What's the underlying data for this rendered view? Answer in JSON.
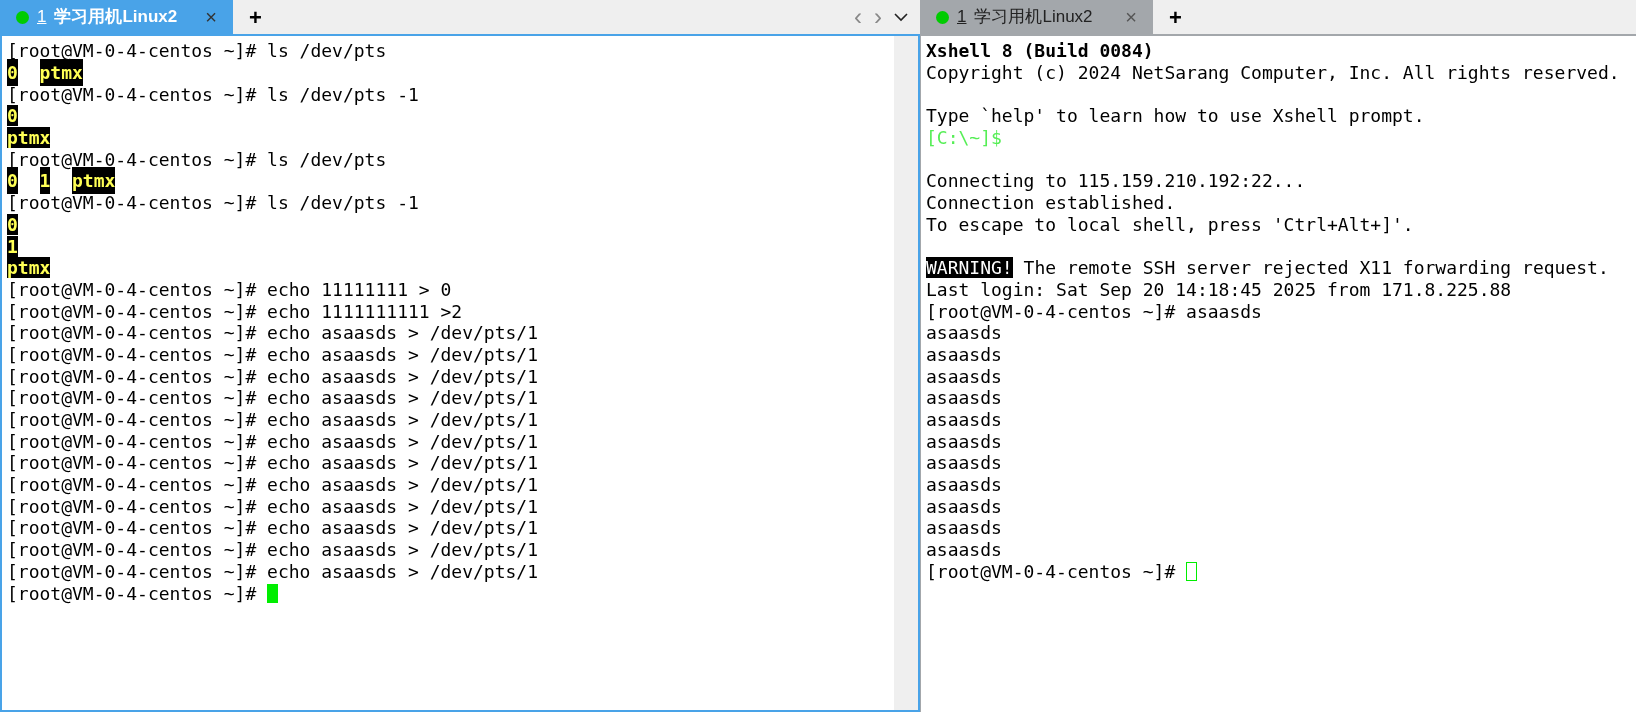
{
  "panes": [
    {
      "focused": true,
      "tab": {
        "color": "#00cc00",
        "number": "1",
        "title": "学习用机Linux2",
        "close": "×"
      },
      "new_tab": "+",
      "nav": {
        "prev": "‹",
        "next": "›"
      },
      "lines": [
        {
          "segments": [
            {
              "text": "[root@VM-0-4-centos ~]# ls /dev/pts",
              "kind": "plain"
            }
          ]
        },
        {
          "kind": "columns",
          "items": [
            "0",
            "ptmx"
          ]
        },
        {
          "segments": [
            {
              "text": "[root@VM-0-4-centos ~]# ls /dev/pts -1",
              "kind": "plain"
            }
          ]
        },
        {
          "segments": [
            {
              "text": "0",
              "kind": "highlight"
            }
          ]
        },
        {
          "segments": [
            {
              "text": "ptmx",
              "kind": "highlight"
            }
          ]
        },
        {
          "segments": [
            {
              "text": "[root@VM-0-4-centos ~]# ls /dev/pts",
              "kind": "plain"
            }
          ]
        },
        {
          "kind": "columns",
          "items": [
            "0",
            "1",
            "ptmx"
          ]
        },
        {
          "segments": [
            {
              "text": "[root@VM-0-4-centos ~]# ls /dev/pts -1",
              "kind": "plain"
            }
          ]
        },
        {
          "segments": [
            {
              "text": "0",
              "kind": "highlight"
            }
          ]
        },
        {
          "segments": [
            {
              "text": "1",
              "kind": "highlight"
            }
          ]
        },
        {
          "segments": [
            {
              "text": "ptmx",
              "kind": "highlight"
            }
          ]
        },
        {
          "segments": [
            {
              "text": "[root@VM-0-4-centos ~]# echo 11111111 > 0",
              "kind": "plain"
            }
          ]
        },
        {
          "segments": [
            {
              "text": "[root@VM-0-4-centos ~]# echo 1111111111 >2",
              "kind": "plain"
            }
          ]
        },
        {
          "segments": [
            {
              "text": "[root@VM-0-4-centos ~]# echo asaasds > /dev/pts/1",
              "kind": "plain"
            }
          ]
        },
        {
          "segments": [
            {
              "text": "[root@VM-0-4-centos ~]# echo asaasds > /dev/pts/1",
              "kind": "plain"
            }
          ]
        },
        {
          "segments": [
            {
              "text": "[root@VM-0-4-centos ~]# echo asaasds > /dev/pts/1",
              "kind": "plain"
            }
          ]
        },
        {
          "segments": [
            {
              "text": "[root@VM-0-4-centos ~]# echo asaasds > /dev/pts/1",
              "kind": "plain"
            }
          ]
        },
        {
          "segments": [
            {
              "text": "[root@VM-0-4-centos ~]# echo asaasds > /dev/pts/1",
              "kind": "plain"
            }
          ]
        },
        {
          "segments": [
            {
              "text": "[root@VM-0-4-centos ~]# echo asaasds > /dev/pts/1",
              "kind": "plain"
            }
          ]
        },
        {
          "segments": [
            {
              "text": "[root@VM-0-4-centos ~]# echo asaasds > /dev/pts/1",
              "kind": "plain"
            }
          ]
        },
        {
          "segments": [
            {
              "text": "[root@VM-0-4-centos ~]# echo asaasds > /dev/pts/1",
              "kind": "plain"
            }
          ]
        },
        {
          "segments": [
            {
              "text": "[root@VM-0-4-centos ~]# echo asaasds > /dev/pts/1",
              "kind": "plain"
            }
          ]
        },
        {
          "segments": [
            {
              "text": "[root@VM-0-4-centos ~]# echo asaasds > /dev/pts/1",
              "kind": "plain"
            }
          ]
        },
        {
          "segments": [
            {
              "text": "[root@VM-0-4-centos ~]# echo asaasds > /dev/pts/1",
              "kind": "plain"
            }
          ]
        },
        {
          "segments": [
            {
              "text": "[root@VM-0-4-centos ~]# echo asaasds > /dev/pts/1",
              "kind": "plain"
            }
          ]
        },
        {
          "segments": [
            {
              "text": "[root@VM-0-4-centos ~]# ",
              "kind": "plain"
            }
          ],
          "cursor": true
        }
      ]
    },
    {
      "focused": false,
      "tab": {
        "color": "#00cc00",
        "number": "1",
        "title": "学习用机Linux2",
        "close": "×"
      },
      "new_tab": "+",
      "lines": [
        {
          "segments": [
            {
              "text": "Xshell 8 (Build 0084)",
              "kind": "bold"
            }
          ]
        },
        {
          "segments": [
            {
              "text": "Copyright (c) 2024 NetSarang Computer, Inc. All rights reserved.",
              "kind": "plain"
            }
          ]
        },
        {
          "kind": "blank"
        },
        {
          "segments": [
            {
              "text": "Type `help' to learn how to use Xshell prompt.",
              "kind": "plain"
            }
          ]
        },
        {
          "segments": [
            {
              "text": "[C:\\~]$",
              "kind": "green"
            }
          ]
        },
        {
          "kind": "blank"
        },
        {
          "segments": [
            {
              "text": "Connecting to 115.159.210.192:22...",
              "kind": "plain"
            }
          ]
        },
        {
          "segments": [
            {
              "text": "Connection established.",
              "kind": "plain"
            }
          ]
        },
        {
          "segments": [
            {
              "text": "To escape to local shell, press 'Ctrl+Alt+]'.",
              "kind": "plain"
            }
          ]
        },
        {
          "kind": "blank"
        },
        {
          "segments": [
            {
              "text": "WARNING!",
              "kind": "inverse"
            },
            {
              "text": " The remote SSH server rejected X11 forwarding request.",
              "kind": "plain"
            }
          ]
        },
        {
          "segments": [
            {
              "text": "Last login: Sat Sep 20 14:18:45 2025 from 171.8.225.88",
              "kind": "plain"
            }
          ]
        },
        {
          "segments": [
            {
              "text": "[root@VM-0-4-centos ~]# asaasds",
              "kind": "plain"
            }
          ]
        },
        {
          "segments": [
            {
              "text": "asaasds",
              "kind": "plain"
            }
          ]
        },
        {
          "segments": [
            {
              "text": "asaasds",
              "kind": "plain"
            }
          ]
        },
        {
          "segments": [
            {
              "text": "asaasds",
              "kind": "plain"
            }
          ]
        },
        {
          "segments": [
            {
              "text": "asaasds",
              "kind": "plain"
            }
          ]
        },
        {
          "segments": [
            {
              "text": "asaasds",
              "kind": "plain"
            }
          ]
        },
        {
          "segments": [
            {
              "text": "asaasds",
              "kind": "plain"
            }
          ]
        },
        {
          "segments": [
            {
              "text": "asaasds",
              "kind": "plain"
            }
          ]
        },
        {
          "segments": [
            {
              "text": "asaasds",
              "kind": "plain"
            }
          ]
        },
        {
          "segments": [
            {
              "text": "asaasds",
              "kind": "plain"
            }
          ]
        },
        {
          "segments": [
            {
              "text": "asaasds",
              "kind": "plain"
            }
          ]
        },
        {
          "segments": [
            {
              "text": "asaasds",
              "kind": "plain"
            }
          ]
        },
        {
          "segments": [
            {
              "text": "[root@VM-0-4-centos ~]# ",
              "kind": "plain"
            }
          ],
          "cursor": true
        }
      ]
    }
  ]
}
